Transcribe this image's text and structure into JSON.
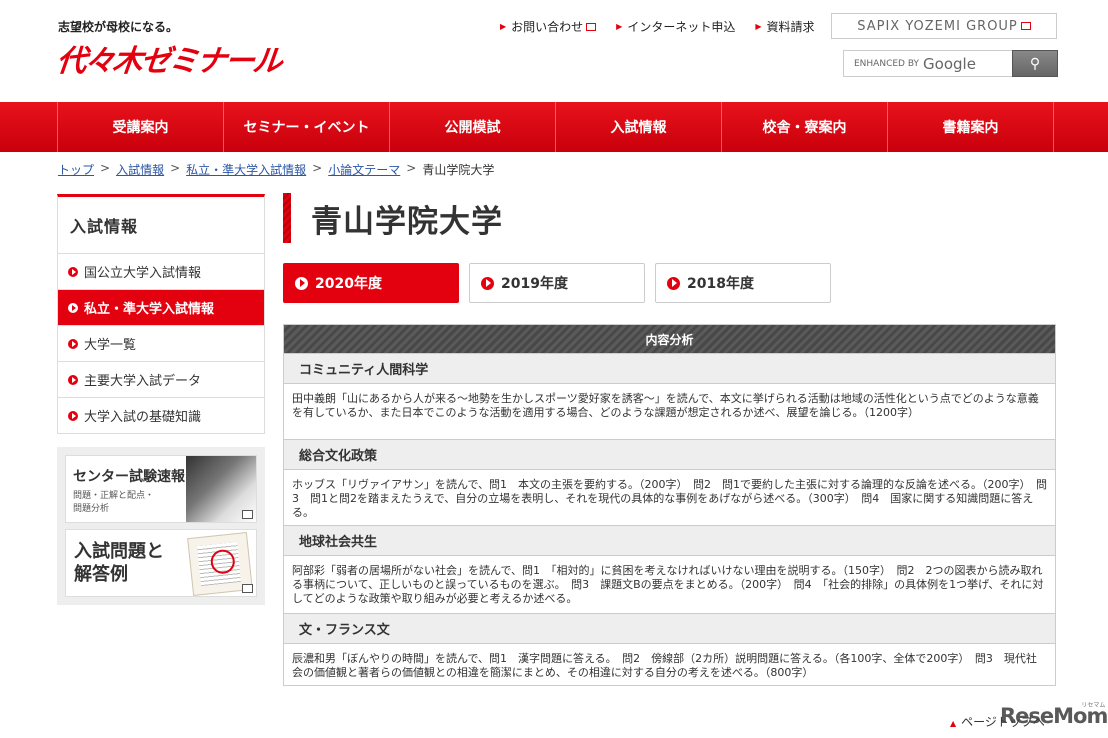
{
  "header": {
    "tagline": "志望校が母校になる。",
    "logo": "代々木ゼミナール",
    "top_links": [
      "お問い合わせ",
      "インターネット申込",
      "資料請求"
    ],
    "group_link": "SAPIX YOZEMI GROUP",
    "search_placeholder_prefix": "ENHANCED BY",
    "search_placeholder_brand": "Google"
  },
  "nav": [
    "受講案内",
    "セミナー・イベント",
    "公開模試",
    "入試情報",
    "校舎・寮案内",
    "書籍案内"
  ],
  "breadcrumb": [
    "トップ",
    "入試情報",
    "私立・準大学入試情報",
    "小論文テーマ",
    "青山学院大学"
  ],
  "sidebar": {
    "heading": "入試情報",
    "items": [
      "国公立大学入試情報",
      "私立・準大学入試情報",
      "大学一覧",
      "主要大学入試データ",
      "大学入試の基礎知識"
    ],
    "banner1_title": "センター試験速報",
    "banner1_sub1": "問題・正解と配点・",
    "banner1_sub2": "問題分析",
    "banner2_title": "入試問題と解答例"
  },
  "main": {
    "title": "青山学院大学",
    "year_tabs": [
      "2020年度",
      "2019年度",
      "2018年度"
    ],
    "table_header": "内容分析",
    "sections": [
      {
        "title": "コミュニティ人間科学",
        "body": "田中義朗「山にあるから人が来る～地勢を生かしスポーツ愛好家を誘客～」を読んで、本文に挙げられる活動は地域の活性化という点でどのような意義を有しているか、また日本でこのような活動を適用する場合、どのような課題が想定されるか述べ、展望を論じる。（1200字）"
      },
      {
        "title": "総合文化政策",
        "body": "ホッブス「リヴァイアサン」を読んで、問1　本文の主張を要約する。（200字）　問2　問1で要約した主張に対する論理的な反論を述べる。（200字）　問3　問1と問2を踏まえたうえで、自分の立場を表明し、それを現代の具体的な事例をあげながら述べる。（300字）　問4　国家に関する知識問題に答える。"
      },
      {
        "title": "地球社会共生",
        "body": "阿部彩「弱者の居場所がない社会」を読んで、問1　「相対的」に貧困を考えなければいけない理由を説明する。（150字）　問2　2つの図表から読み取れる事柄について、正しいものと誤っているものを選ぶ。　問3　課題文Bの要点をまとめる。（200字）　問4　「社会的排除」の具体例を1つ挙げ、それに対してどのような政策や取り組みが必要と考えるか述べる。"
      },
      {
        "title": "文・フランス文",
        "body": "辰濃和男「ぼんやりの時間」を読んで、問1　漢字問題に答える。　問2　傍線部（2カ所）説明問題に答える。（各100字、全体で200字）　問3　現代社会の価値観と著者らの価値観との相違を簡潔にまとめ、その相違に対する自分の考えを述べる。（800字）"
      }
    ]
  },
  "footer": {
    "page_top": "ページトップへ",
    "watermark": "ReseMom",
    "watermark_sub": "リセマム"
  }
}
